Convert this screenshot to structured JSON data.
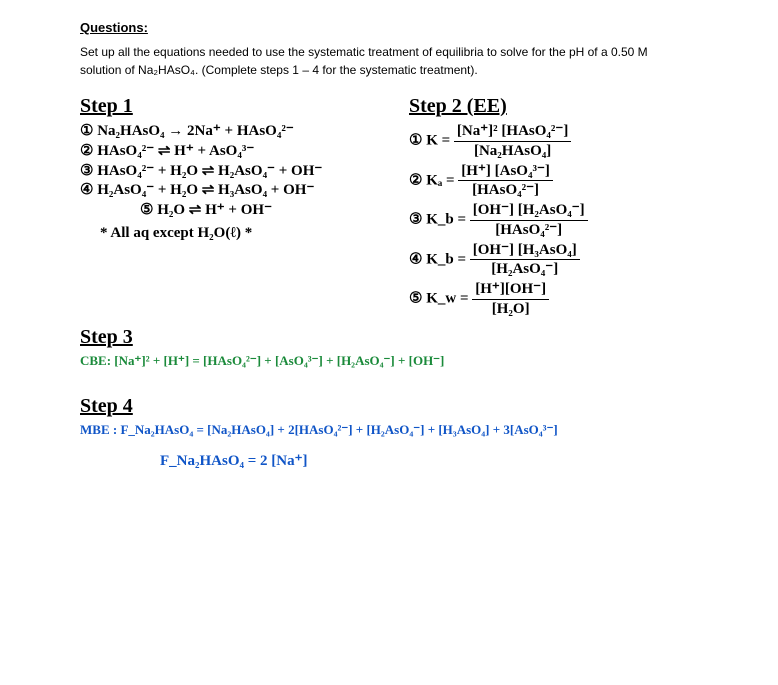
{
  "title": "Questions:",
  "prompt": "Set up all the equations needed to use the systematic treatment of equilibria to solve for the pH of a 0.50 M solution of Na₂HAsO₄. (Complete steps 1 – 4 for the systematic treatment).",
  "step1_head": "Step 1",
  "eq1": "① Na₂HAsO₄  →  2Na⁺  +  HAsO₄²⁻",
  "eq2": "② HAsO₄²⁻  ⇌  H⁺  +  AsO₄³⁻",
  "eq3": "③ HAsO₄²⁻ + H₂O  ⇌  H₂AsO₄⁻  +  OH⁻",
  "eq4": "④ H₂AsO₄⁻ + H₂O  ⇌  H₃AsO₄  +  OH⁻",
  "eq5": "⑤ H₂O  ⇌  H⁺  +  OH⁻",
  "note": "* All aq except H₂O(ℓ) *",
  "step2_head": "Step 2  (EE)",
  "k1_lhs": "① K =",
  "k1_top": "[Na⁺]² [HAsO₄²⁻]",
  "k1_bot": "[Na₂HAsO₄]",
  "k2_lhs": "② Kₐ =",
  "k2_top": "[H⁺] [AsO₄³⁻]",
  "k2_bot": "[HAsO₄²⁻]",
  "k3_lhs": "③ K_b =",
  "k3_top": "[OH⁻] [H₂AsO₄⁻]",
  "k3_bot": "[HAsO₄²⁻]",
  "k4_lhs": "④ K_b =",
  "k4_top": "[OH⁻] [H₃AsO₄]",
  "k4_bot": "[H₂AsO₄⁻]",
  "k5_lhs": "⑤ K_w =",
  "k5_top": "[H⁺][OH⁻]",
  "k5_bot": "[H₂O]",
  "step3_head": "Step 3",
  "cbe": "CBE:  [Na⁺]²  +  [H⁺]  =  [HAsO₄²⁻]  +  [AsO₄³⁻]  +  [H₂AsO₄⁻]  +  [OH⁻]",
  "step4_head": "Step 4",
  "mbe1": "MBE :  F_Na₂HAsO₄  =  [Na₂HAsO₄] + 2[HAsO₄²⁻] + [H₂AsO₄⁻] + [H₃AsO₄] + 3[AsO₄³⁻]",
  "mbe2": "F_Na₂HAsO₄  =  2 [Na⁺]"
}
